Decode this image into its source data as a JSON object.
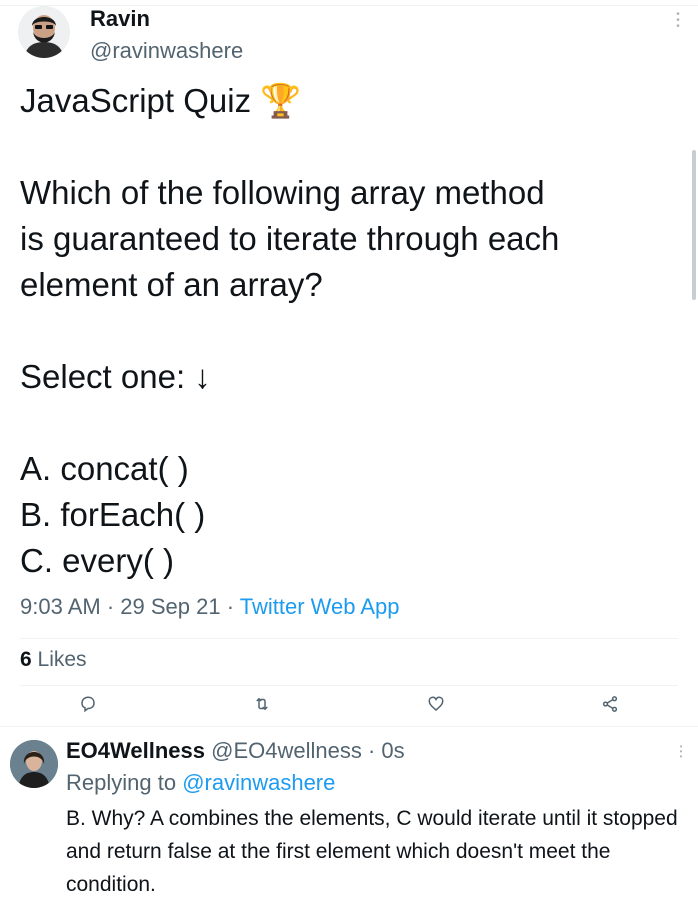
{
  "author": {
    "name": "Ravin",
    "handle": "@ravinwashere"
  },
  "tweet": {
    "text": "JavaScript Quiz 🏆\n\nWhich of the following array method\nis guaranteed to iterate through each\nelement of an array?\n\nSelect one: ↓\n\nA. concat( )\nB. forEach( )\nC. every( )",
    "time": "9:03 AM",
    "date": "29 Sep 21",
    "separator": " · ",
    "app": "Twitter Web App",
    "likes_count": "6",
    "likes_label": "Likes"
  },
  "actions": {
    "reply_icon": "reply-icon",
    "retweet_icon": "retweet-icon",
    "like_icon": "like-icon",
    "share_icon": "share-icon"
  },
  "reply": {
    "name": "EO4Wellness",
    "handle": "@EO4wellness",
    "time": "0s",
    "replying_to_label": "Replying to ",
    "replying_to_handle": "@ravinwashere",
    "text": "B. Why? A combines the elements, C would iterate until it stopped and return false at the first element which doesn't meet the condition."
  },
  "colors": {
    "accent": "#1d9bf0",
    "secondary_text": "#536471",
    "primary_text": "#0f1419",
    "divider": "#eff3f4"
  }
}
